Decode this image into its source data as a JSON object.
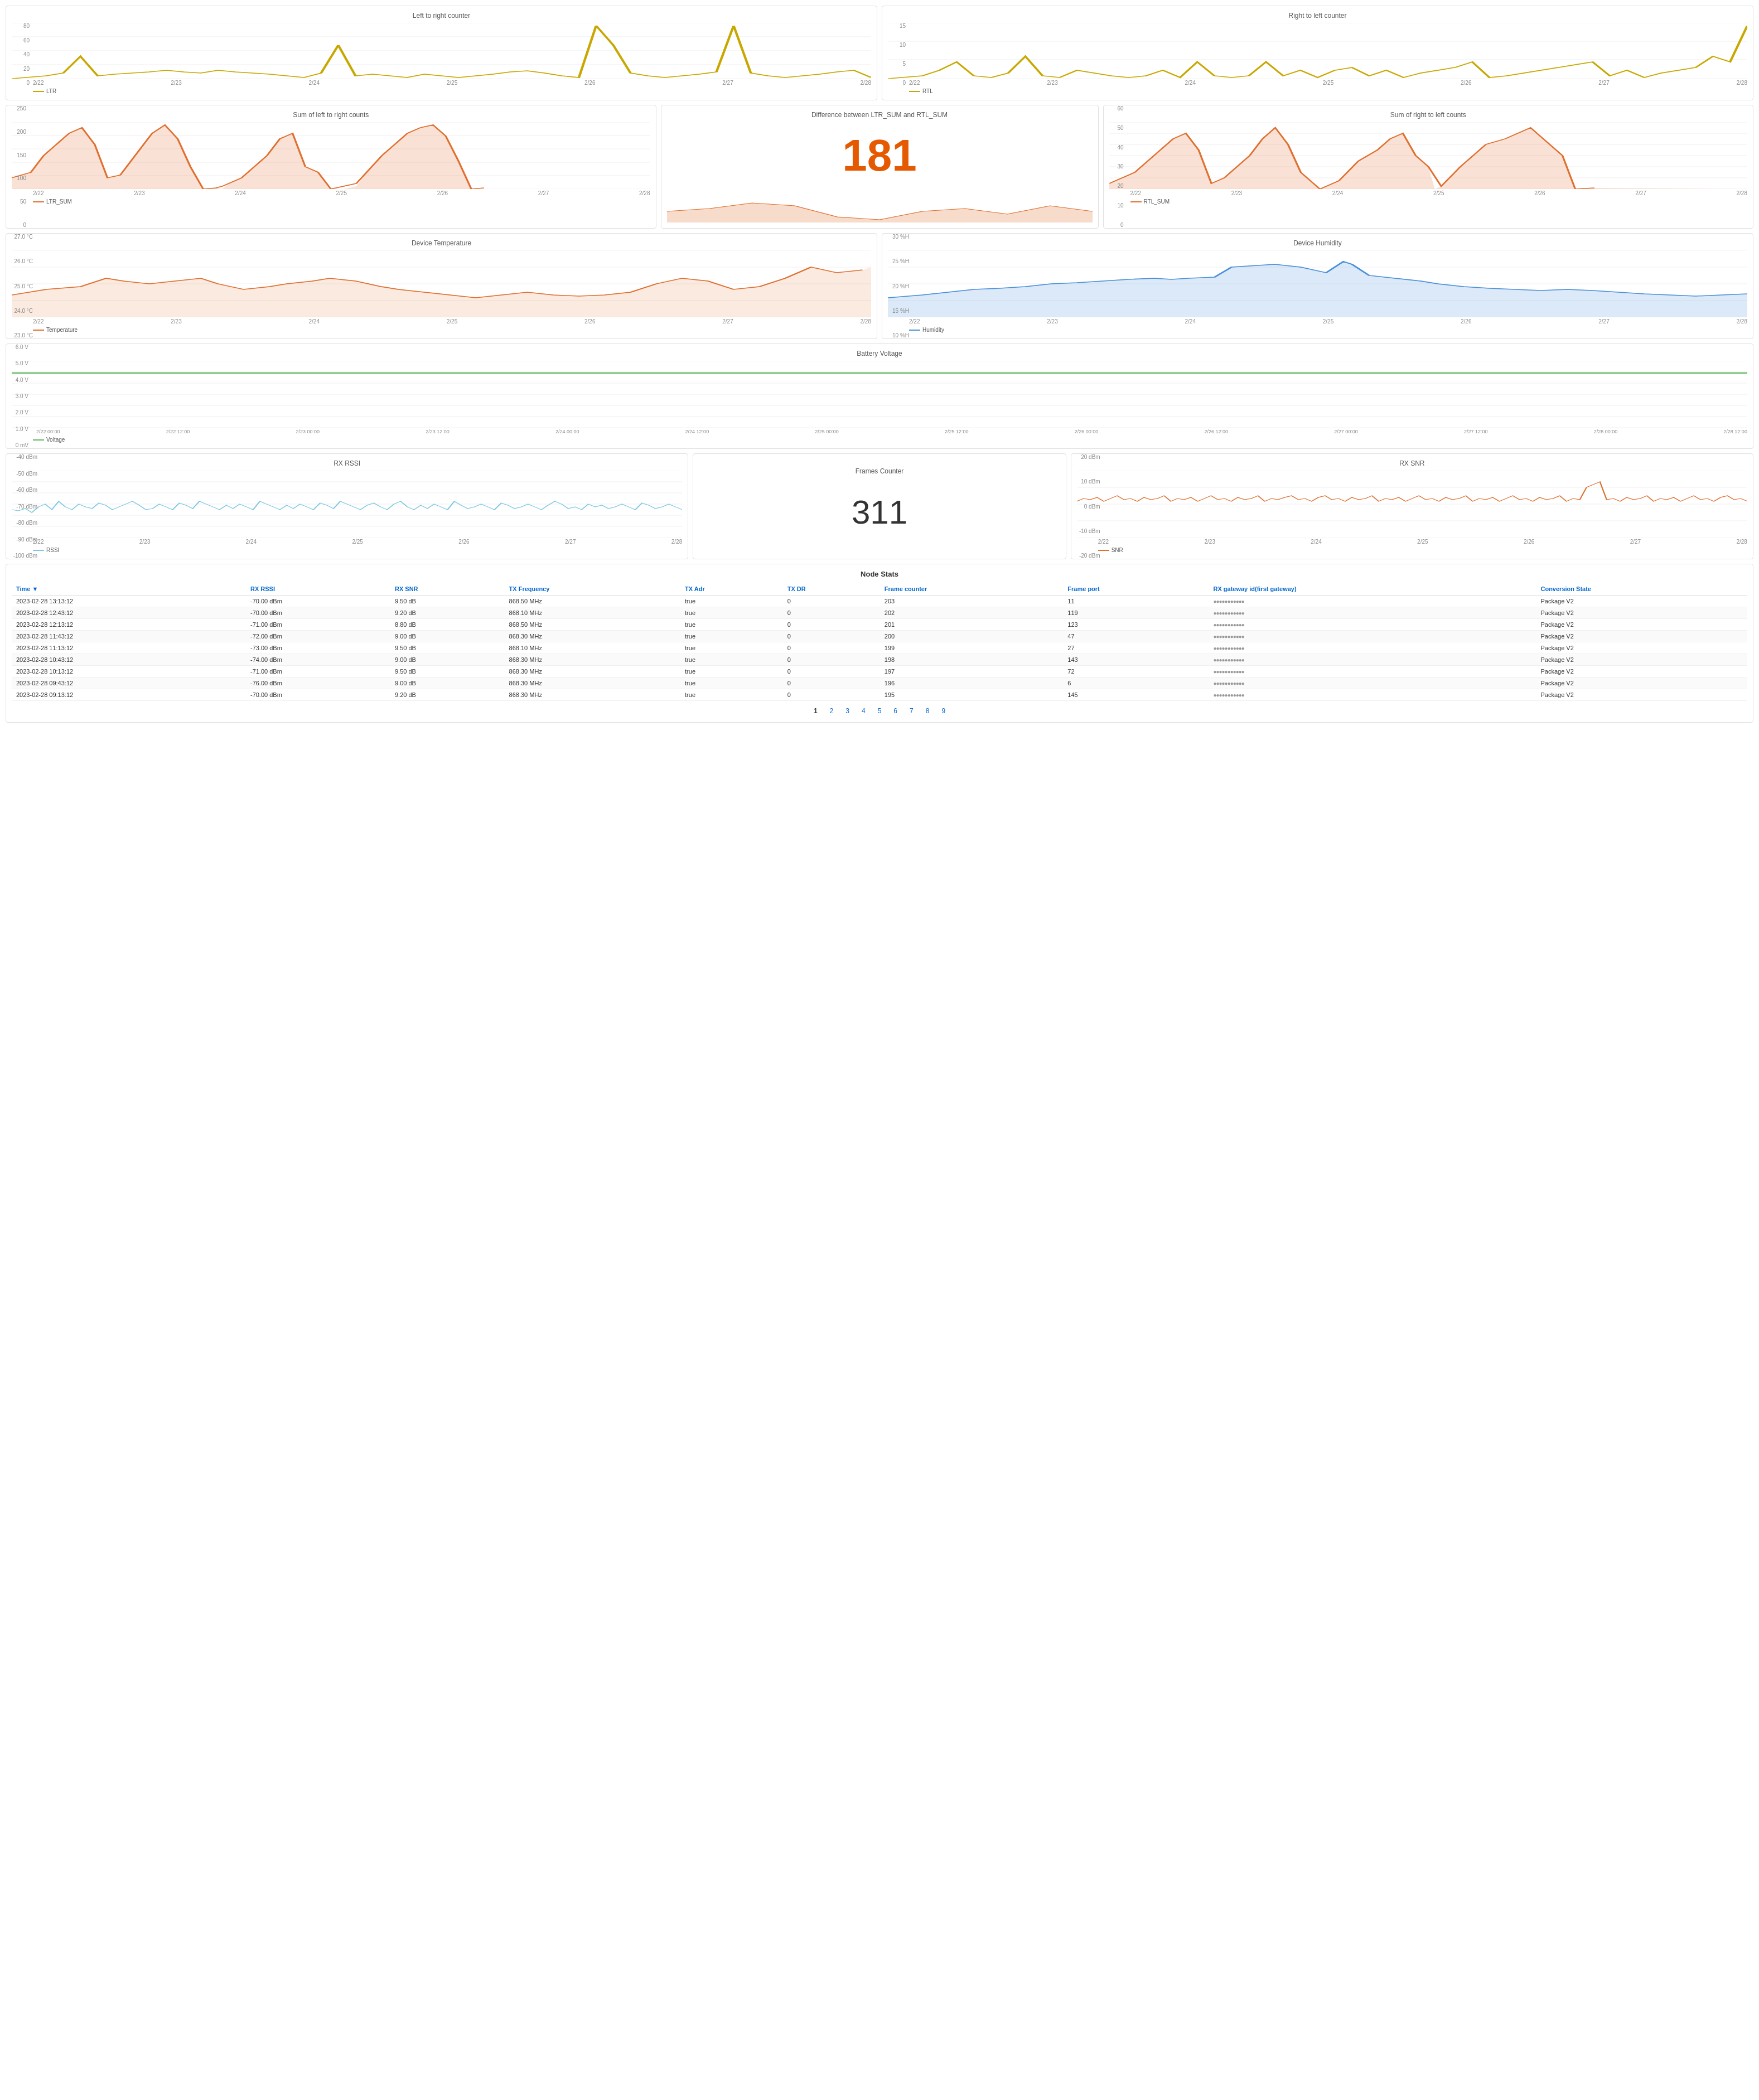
{
  "charts": {
    "ltr": {
      "title": "Left to right counter",
      "legend": "LTR",
      "color": "#c8a800",
      "yLabels": [
        "80",
        "60",
        "40",
        "20",
        "0"
      ],
      "xLabels": [
        "2/22",
        "2/23",
        "2/24",
        "2/25",
        "2/26",
        "2/27",
        "2/28"
      ]
    },
    "rtl": {
      "title": "Right to left counter",
      "legend": "RTL",
      "color": "#c8a800",
      "yLabels": [
        "15",
        "10",
        "5",
        "0"
      ],
      "xLabels": [
        "2/22",
        "2/23",
        "2/24",
        "2/25",
        "2/26",
        "2/27",
        "2/28"
      ]
    },
    "ltr_sum": {
      "title": "Sum of left to right counts",
      "legend": "LTR_SUM",
      "color": "#e07030",
      "yLabels": [
        "250",
        "200",
        "150",
        "100",
        "50",
        "0"
      ],
      "xLabels": [
        "2/22",
        "2/23",
        "2/24",
        "2/25",
        "2/26",
        "2/27",
        "2/28"
      ]
    },
    "diff": {
      "title": "Difference between LTR_SUM and RTL_SUM",
      "bigNumber": "181"
    },
    "rtl_sum": {
      "title": "Sum of right to left counts",
      "legend": "RTL_SUM",
      "color": "#e07030",
      "yLabels": [
        "60",
        "50",
        "40",
        "30",
        "20",
        "10",
        "0"
      ],
      "xLabels": [
        "2/22",
        "2/23",
        "2/24",
        "2/25",
        "2/26",
        "2/27",
        "2/28"
      ]
    },
    "temp": {
      "title": "Device Temperature",
      "legend": "Temperature",
      "color": "#e07030",
      "yLabels": [
        "27.0 °C",
        "26.0 °C",
        "25.0 °C",
        "24.0 °C",
        "23.0 °C"
      ],
      "xLabels": [
        "2/22",
        "2/23",
        "2/24",
        "2/25",
        "2/26",
        "2/27",
        "2/28"
      ]
    },
    "humidity": {
      "title": "Device Humidity",
      "legend": "Humidity",
      "color": "#4a90d9",
      "yLabels": [
        "30 %H",
        "25 %H",
        "20 %H",
        "15 %H",
        "10 %H"
      ],
      "xLabels": [
        "2/22",
        "2/23",
        "2/24",
        "2/25",
        "2/26",
        "2/27",
        "2/28"
      ]
    },
    "voltage": {
      "title": "Battery Voltage",
      "legend": "Voltage",
      "color": "#5cb85c",
      "yLabels": [
        "6.0 V",
        "5.0 V",
        "4.0 V",
        "3.0 V",
        "2.0 V",
        "1.0 V",
        "0 mV"
      ],
      "xLabels": [
        "2/22 00:00",
        "2/22 12:00",
        "2/23 00:00",
        "2/23 12:00",
        "2/24 00:00",
        "2/24 12:00",
        "2/25 00:00",
        "2/25 12:00",
        "2/26 00:00",
        "2/26 12:00",
        "2/27 00:00",
        "2/27 12:00",
        "2/28 00:00",
        "2/28 12:00"
      ]
    },
    "rssi": {
      "title": "RX RSSI",
      "legend": "RSSI",
      "color": "#7ec8e3",
      "yLabels": [
        "-40 dBm",
        "-50 dBm",
        "-60 dBm",
        "-70 dBm",
        "-80 dBm",
        "-90 dBm",
        "-100 dBm"
      ],
      "xLabels": [
        "2/22",
        "2/23",
        "2/24",
        "2/25",
        "2/26",
        "2/27",
        "2/28"
      ]
    },
    "frames": {
      "title": "Frames Counter",
      "value": "311"
    },
    "snr": {
      "title": "RX SNR",
      "legend": "SNR",
      "color": "#e07030",
      "yLabels": [
        "20 dBm",
        "10 dBm",
        "0 dBm",
        "-10 dBm",
        "-20 dBm"
      ],
      "xLabels": [
        "2/22",
        "2/23",
        "2/24",
        "2/25",
        "2/26",
        "2/27",
        "2/28"
      ]
    }
  },
  "table": {
    "title": "Node Stats",
    "columns": [
      "Time ▼",
      "RX RSSI",
      "RX SNR",
      "TX Frequency",
      "TX Adr",
      "TX DR",
      "Frame counter",
      "Frame port",
      "RX gateway id(first gateway)",
      "Conversion State"
    ],
    "rows": [
      [
        "2023-02-28 13:13:12",
        "-70.00 dBm",
        "9.50 dB",
        "868.50 MHz",
        "true",
        "0",
        "203",
        "11",
        "●●●●●●●●●●●",
        "Package V2"
      ],
      [
        "2023-02-28 12:43:12",
        "-70.00 dBm",
        "9.20 dB",
        "868.10 MHz",
        "true",
        "0",
        "202",
        "119",
        "●●●●●●●●●●●",
        "Package V2"
      ],
      [
        "2023-02-28 12:13:12",
        "-71.00 dBm",
        "8.80 dB",
        "868.50 MHz",
        "true",
        "0",
        "201",
        "123",
        "●●●●●●●●●●●",
        "Package V2"
      ],
      [
        "2023-02-28 11:43:12",
        "-72.00 dBm",
        "9.00 dB",
        "868.30 MHz",
        "true",
        "0",
        "200",
        "47",
        "●●●●●●●●●●●",
        "Package V2"
      ],
      [
        "2023-02-28 11:13:12",
        "-73.00 dBm",
        "9.50 dB",
        "868.10 MHz",
        "true",
        "0",
        "199",
        "27",
        "●●●●●●●●●●●",
        "Package V2"
      ],
      [
        "2023-02-28 10:43:12",
        "-74.00 dBm",
        "9.00 dB",
        "868.30 MHz",
        "true",
        "0",
        "198",
        "143",
        "●●●●●●●●●●●",
        "Package V2"
      ],
      [
        "2023-02-28 10:13:12",
        "-71.00 dBm",
        "9.50 dB",
        "868.30 MHz",
        "true",
        "0",
        "197",
        "72",
        "●●●●●●●●●●●",
        "Package V2"
      ],
      [
        "2023-02-28 09:43:12",
        "-76.00 dBm",
        "9.00 dB",
        "868.30 MHz",
        "true",
        "0",
        "196",
        "6",
        "●●●●●●●●●●●",
        "Package V2"
      ],
      [
        "2023-02-28 09:13:12",
        "-70.00 dBm",
        "9.20 dB",
        "868.30 MHz",
        "true",
        "0",
        "195",
        "145",
        "●●●●●●●●●●●",
        "Package V2"
      ]
    ],
    "pagination": [
      "1",
      "2",
      "3",
      "4",
      "5",
      "6",
      "7",
      "8",
      "9"
    ]
  }
}
